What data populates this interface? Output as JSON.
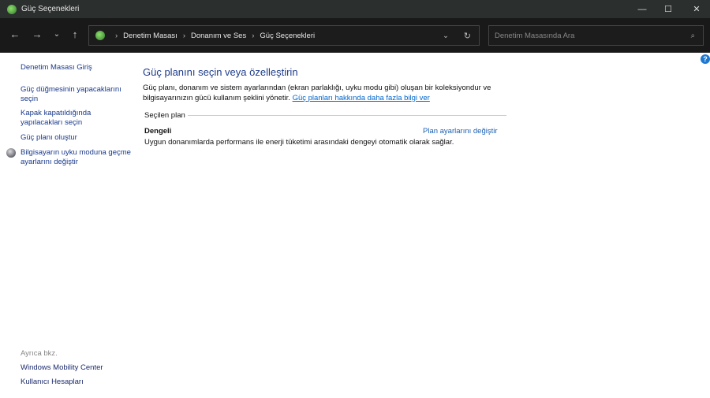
{
  "window": {
    "title": "Güç Seçenekleri"
  },
  "address": {
    "breadcrumbs": [
      "Denetim Masası",
      "Donanım ve Ses",
      "Güç Seçenekleri"
    ]
  },
  "search": {
    "placeholder": "Denetim Masasında Ara"
  },
  "sidebar": {
    "home": "Denetim Masası Giriş",
    "items": [
      "Güç düğmesinin yapacaklarını seçin",
      "Kapak kapatıldığında yapılacakları seçin",
      "Güç planı oluştur",
      "Bilgisayarın uyku moduna geçme ayarlarını değiştir"
    ],
    "see_also": "Ayrıca bkz.",
    "links": [
      "Windows Mobility Center",
      "Kullanıcı Hesapları"
    ]
  },
  "main": {
    "title": "Güç planını seçin veya özelleştirin",
    "description": "Güç planı, donanım ve sistem ayarlarından (ekran parlaklığı, uyku modu gibi) oluşan bir koleksiyondur ve bilgisayarınızın gücü kullanım şeklini yönetir. ",
    "learn_more": "Güç planları hakkında daha fazla bilgi ver",
    "selected_label": "Seçilen plan",
    "plan_name": "Dengeli",
    "plan_link": "Plan ayarlarını değiştir",
    "plan_description": "Uygun donanımlarda performans ile enerji tüketimi arasındaki dengeyi otomatik olarak sağlar."
  }
}
